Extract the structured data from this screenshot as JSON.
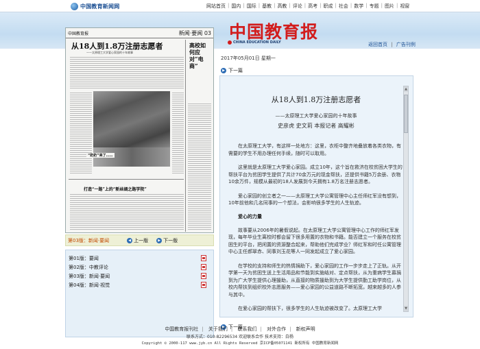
{
  "topbar": {
    "logo_text": "中国教育新闻网",
    "nav": [
      "网站首页",
      "国内",
      "国际",
      "基教",
      "高教",
      "评论",
      "高考",
      "职成",
      "社会",
      "数学",
      "专题",
      "图片",
      "视窗"
    ]
  },
  "header": {
    "masthead": "中国教育报",
    "subtitle": "CHINA EDUCATION DAILY",
    "links": [
      "返回首页",
      "广告刊例"
    ],
    "link_sep": "|"
  },
  "paper": {
    "masthead": "中国教育报",
    "section": "新闻·要闻 03",
    "headline": "从18人到1.8万注册志愿者",
    "subhead": "——太原理工大学爱心家园的十年故事",
    "photo_caption": "“奶奶”来了……",
    "side_headline": "高校如何应对“电商”",
    "mid_headline": "打造“一路”上的“新丝绸之路学院”"
  },
  "page_nav": {
    "current": "第03版：新闻·要闻",
    "prev_label": "上一版",
    "next_label": "下一版",
    "prev_icon": "◀",
    "next_icon": "▶"
  },
  "page_list": [
    {
      "label": "第01版：要闻"
    },
    {
      "label": "第02版：中教评论"
    },
    {
      "label": "第03版：新闻·要闻"
    },
    {
      "label": "第04版：新闻·视觉"
    }
  ],
  "article": {
    "date": "2017年05月01日  星期一",
    "next_label": "下一篇",
    "next_icon": "▶",
    "title": "从18人到1.8万注册志愿者",
    "subtitle": "——太原理工大学爱心家园的十年故事",
    "byline": "史彦虎  史文莉  本报记者  高耀彬",
    "paragraphs_1": [
      "在太原理工大学，有这样一处地方：这里，衣柜中整齐地叠放着各类衣物，有需要的学生不用办理任何手续，随时可以取用。",
      "这里就是太原理工大学爱心家园。成立10年，这个旨在救济在校贫困大学生的帮扶平台为贫困学生提供了共计70余万元的现金帮扶，还提供书籍5万余册、衣物10余万件，规模从最初的18人发展到今天拥有1.8万名注册志愿者。",
      "爱心家园的创立者之一——太原理工大学公寓管理中心主任师红军没有想到，10年前他和几名同事的一个想法，会影响很多学生的人生轨迹。"
    ],
    "section_heading": "爱心的力量",
    "paragraphs_2": [
      "故事要从2006年的暑假说起。在太原理工大学公寓管理中心工作的师红军发现，每年毕业生离校时都会留下很多用置的衣物和书籍。能否建立一个服务在校贫困生的平台，把闲置的资源整合起来，帮助他们完成学业？师红军和时任公寓管理中心主任郝翠赤、同事刘玉花等人一同发起成立了爱心家园。",
      "在学校的支持和师生的热情捐助下，爱心家园的工作一步步走上了正轨。从开学第一天为贫困生送上生活用品和节能到实施结对、定点帮扶，从为重病学生募捐到为广大学生提供心理援助，从直接的物质援助到为大学生提供勤工助学岗位，从校内帮扶到组织校外志愿服务——爱心家园的公益道路不断拓宽，越来越多的人参与其中。",
      "在爱心家园的帮扶下，很多学生的人生轨迹被改变了。太原理工大学"
    ]
  },
  "footer": {
    "links": [
      "中国教育报刊社",
      "关于我们",
      "联系我们",
      "对外合作",
      "新权声明"
    ],
    "line1": "联系方式：010-82296534  欢迎联系合作  技术支持：白杨",
    "line2": "Copyright © 2000-117 www.jyb.cn All Rights Reserved 京ICP备05071141 新权所有 中国教育新闻网"
  }
}
